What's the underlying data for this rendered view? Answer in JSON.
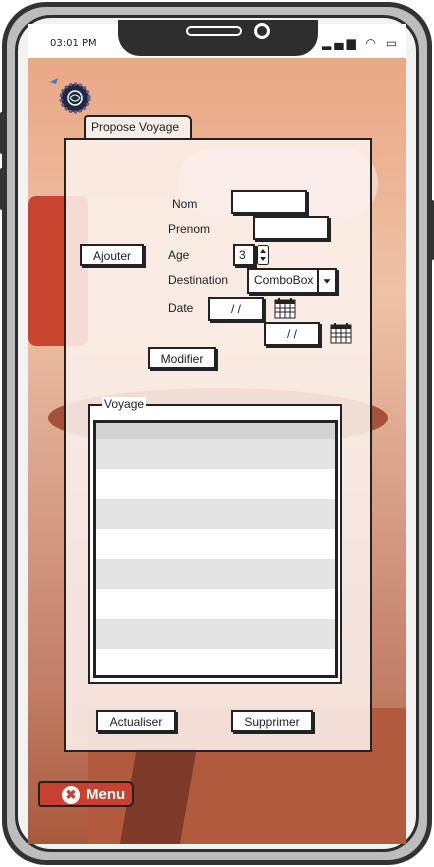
{
  "status_bar": {
    "time": "03:01 PM",
    "icons": [
      "signal-icon",
      "wifi-icon",
      "battery-icon"
    ]
  },
  "tab": {
    "label": "Propose Voyage"
  },
  "form": {
    "nom_label": "Nom",
    "prenom_label": "Prenom",
    "age_label": "Age",
    "age_value": "3",
    "destination_label": "Destination",
    "destination_value": "ComboBox",
    "date_label": "Date",
    "date_start_value": "/ /",
    "date_end_value": "/ /"
  },
  "buttons": {
    "ajouter": "Ajouter",
    "modifier": "Modifier",
    "actualiser": "Actualiser",
    "supprimer": "Supprimer",
    "menu": "Menu"
  },
  "voyage_group": {
    "title": "Voyage"
  },
  "colors": {
    "menu_button": "#c8402e",
    "background_accent": "#e9a886"
  }
}
